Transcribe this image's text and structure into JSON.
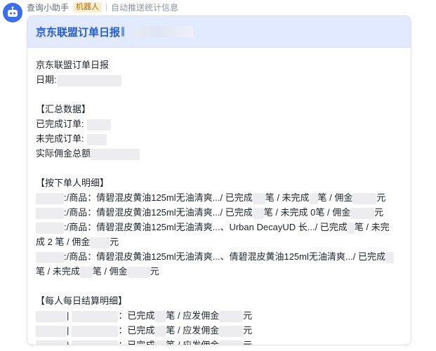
{
  "sender": {
    "name": "查询小助手",
    "badge": "机器人",
    "description": "自动推送统计信息"
  },
  "card": {
    "title": "京东联盟订单日报",
    "body": {
      "heading": "京东联盟订单日报",
      "date_label": "日期:",
      "summary_header": "【汇总数据】",
      "completed_label": "已完成订单:",
      "incomplete_label": "未完成订单:",
      "commission_label": "实际佣金总额",
      "detail_header": "【按下单人明细】",
      "detail_rows": [
        {
          "a": ":/商品：倩碧混皮黄油125ml无油清爽...",
          "b": "/ 已完成",
          "c": "笔 / 未完成",
          "d": "笔 / 佣金",
          "e": "元"
        },
        {
          "a": ":/商品：倩碧混皮黄油125ml无油清爽...",
          "b": "/ 已完成",
          "c": "笔 / 未完成 0",
          "d": "笔 / 佣金",
          "e": "元"
        },
        {
          "a": ":/商品：倩碧混皮黄油125ml无油清爽...、Urban DecayUD 长...",
          "b": "/ 已完成",
          "c": "笔 / 未完",
          "d": "成 2 笔 / 佣金",
          "e": "元"
        },
        {
          "a": ":/商品：倩碧混皮黄油125ml无油清爽...、倩碧混皮黄油125ml无油清爽...",
          "b": "/ 已完成",
          "c": "笔 / 未完成",
          "d": "笔 / 佣金",
          "e": "元"
        }
      ],
      "settle_header": "【每人每日结算明细】",
      "settle_rows": [
        {
          "a": "|",
          "b": "：已完成",
          "c": "笔 / 应发佣金",
          "d": "元"
        },
        {
          "a": "|",
          "b": "：已完成",
          "c": "笔 / 应发佣金",
          "d": "元"
        },
        {
          "a": "|",
          "b": "：已完成",
          "c": "笔 / 应发佣金",
          "d": "元"
        }
      ]
    }
  },
  "colors": {
    "accent": "#245bdb",
    "header_bg": "#e1eaff",
    "avatar": "#3a6df0",
    "badge_bg": "#fdf0d2",
    "badge_text": "#b26a00"
  },
  "icons": {
    "avatar": "robot-icon"
  }
}
